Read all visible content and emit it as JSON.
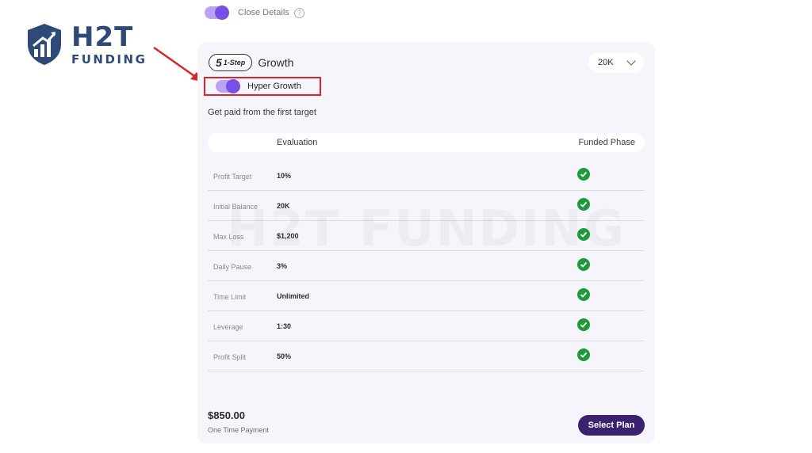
{
  "logo": {
    "main": "H2T",
    "sub": "FUNDING"
  },
  "details_toggle": {
    "label": "Close Details",
    "on": true,
    "help_icon": "question-circle-icon"
  },
  "plan": {
    "step_number": "5",
    "step_text": "1-Step",
    "name": "Growth",
    "size": "20K",
    "hyper_toggle": {
      "label": "Hyper Growth",
      "on": true
    },
    "tagline": "Get paid from the first target"
  },
  "table": {
    "headers": {
      "evaluation": "Evaluation",
      "funded": "Funded Phase"
    },
    "rows": [
      {
        "label": "Profit Target",
        "value": "10%",
        "funded": true
      },
      {
        "label": "Initial Balance",
        "value": "20K",
        "funded": true
      },
      {
        "label": "Max Loss",
        "value": "$1,200",
        "funded": true
      },
      {
        "label": "Daily Pause",
        "value": "3%",
        "funded": true
      },
      {
        "label": "Time Limit",
        "value": "Unlimited",
        "funded": true
      },
      {
        "label": "Leverage",
        "value": "1:30",
        "funded": true
      },
      {
        "label": "Profit Split",
        "value": "50%",
        "funded": true
      }
    ]
  },
  "watermark": "H2T FUNDING",
  "footer": {
    "price": "$850.00",
    "price_note": "One Time Payment",
    "select_label": "Select Plan"
  },
  "colors": {
    "accent": "#7a4fe6",
    "button": "#3a226e",
    "check": "#1f9a3a",
    "highlight": "#d9252a",
    "logo": "#2f4a78"
  }
}
